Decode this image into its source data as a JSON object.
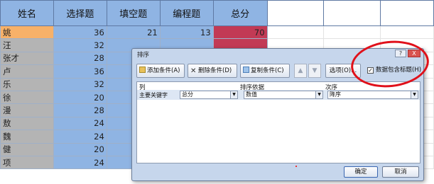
{
  "spreadsheet": {
    "headers": [
      "姓名",
      "选择题",
      "填空题",
      "编程题",
      "总分"
    ],
    "rows": [
      {
        "name": "姚",
        "choice": "36",
        "fill": "21",
        "prog": "13",
        "total": "70"
      },
      {
        "name": "汪",
        "choice": "32",
        "fill": "",
        "prog": "",
        "total": ""
      },
      {
        "name": "张才",
        "choice": "28",
        "fill": "",
        "prog": "",
        "total": ""
      },
      {
        "name": "卢",
        "choice": "36",
        "fill": "",
        "prog": "",
        "total": ""
      },
      {
        "name": "乐",
        "choice": "32",
        "fill": "",
        "prog": "",
        "total": ""
      },
      {
        "name": "徐",
        "choice": "20",
        "fill": "",
        "prog": "",
        "total": ""
      },
      {
        "name": "漫",
        "choice": "28",
        "fill": "",
        "prog": "",
        "total": ""
      },
      {
        "name": "敖",
        "choice": "24",
        "fill": "",
        "prog": "",
        "total": ""
      },
      {
        "name": "魏",
        "choice": "24",
        "fill": "",
        "prog": "",
        "total": ""
      },
      {
        "name": "健",
        "choice": "20",
        "fill": "",
        "prog": "",
        "total": ""
      },
      {
        "name": "项",
        "choice": "24",
        "fill": "",
        "prog": "",
        "total": ""
      }
    ]
  },
  "dialog": {
    "title": "排序",
    "help": "?",
    "close": "X",
    "toolbar": {
      "add": "添加条件(A)",
      "delete": "删除条件(D)",
      "copy": "复制条件(C)",
      "up": "▲",
      "down": "▼",
      "options": "选项(O)...",
      "has_header": "数据包含标题(H)",
      "has_header_checked": true
    },
    "columns": {
      "col": "列",
      "sort_on": "排序依据",
      "order": "次序"
    },
    "criteria": {
      "label": "主要关键字",
      "key": "总分",
      "sort_on": "数值",
      "order": "降序"
    },
    "ok": "确定",
    "cancel": "取消"
  },
  "colors": {
    "header_blue": "#8fb4e3",
    "selected_orange": "#f7b169",
    "total_red": "#c23a55",
    "annotation_red": "#e0101a"
  }
}
